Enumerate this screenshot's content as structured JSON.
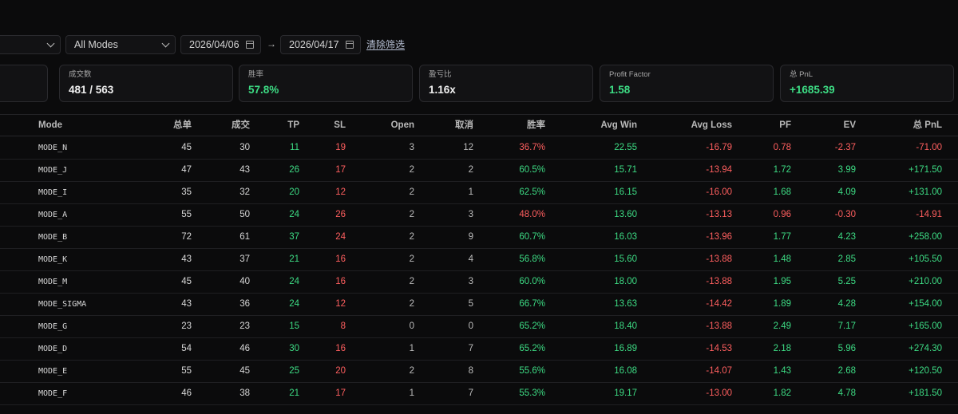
{
  "filters": {
    "mode_select": {
      "value": "All Modes"
    },
    "date_from": "2026/04/06",
    "date_to": "2026/04/17",
    "range_arrow": "→",
    "clear_label": "清除筛选"
  },
  "stats": [
    {
      "label": "成交数",
      "value": "481 / 563",
      "tone": "neutral"
    },
    {
      "label": "胜率",
      "value": "57.8%",
      "tone": "green"
    },
    {
      "label": "盈亏比",
      "value": "1.16x",
      "tone": "neutral"
    },
    {
      "label": "Profit Factor",
      "value": "1.58",
      "tone": "green"
    },
    {
      "label": "总 PnL",
      "value": "+1685.39",
      "tone": "green"
    }
  ],
  "table": {
    "columns": [
      "Mode",
      "总单",
      "成交",
      "TP",
      "SL",
      "Open",
      "取消",
      "胜率",
      "Avg Win",
      "Avg Loss",
      "PF",
      "EV",
      "总 PnL"
    ],
    "rows": [
      {
        "mode": "MODE_N",
        "total": "45",
        "filled": "30",
        "tp": "11",
        "sl": "19",
        "open": "3",
        "cancel": "12",
        "winrate": "36.7%",
        "winrate_tone": "neg",
        "avg_win": "22.55",
        "avg_loss": "-16.79",
        "pf": "0.78",
        "pf_tone": "neg",
        "ev": "-2.37",
        "ev_tone": "neg",
        "pnl": "-71.00",
        "pnl_tone": "neg"
      },
      {
        "mode": "MODE_J",
        "total": "47",
        "filled": "43",
        "tp": "26",
        "sl": "17",
        "open": "2",
        "cancel": "2",
        "winrate": "60.5%",
        "winrate_tone": "pos",
        "avg_win": "15.71",
        "avg_loss": "-13.94",
        "pf": "1.72",
        "pf_tone": "pos",
        "ev": "3.99",
        "ev_tone": "pos",
        "pnl": "+171.50",
        "pnl_tone": "pos"
      },
      {
        "mode": "MODE_I",
        "total": "35",
        "filled": "32",
        "tp": "20",
        "sl": "12",
        "open": "2",
        "cancel": "1",
        "winrate": "62.5%",
        "winrate_tone": "pos",
        "avg_win": "16.15",
        "avg_loss": "-16.00",
        "pf": "1.68",
        "pf_tone": "pos",
        "ev": "4.09",
        "ev_tone": "pos",
        "pnl": "+131.00",
        "pnl_tone": "pos"
      },
      {
        "mode": "MODE_A",
        "total": "55",
        "filled": "50",
        "tp": "24",
        "sl": "26",
        "open": "2",
        "cancel": "3",
        "winrate": "48.0%",
        "winrate_tone": "neg",
        "avg_win": "13.60",
        "avg_loss": "-13.13",
        "pf": "0.96",
        "pf_tone": "neg",
        "ev": "-0.30",
        "ev_tone": "neg",
        "pnl": "-14.91",
        "pnl_tone": "neg"
      },
      {
        "mode": "MODE_B",
        "total": "72",
        "filled": "61",
        "tp": "37",
        "sl": "24",
        "open": "2",
        "cancel": "9",
        "winrate": "60.7%",
        "winrate_tone": "pos",
        "avg_win": "16.03",
        "avg_loss": "-13.96",
        "pf": "1.77",
        "pf_tone": "pos",
        "ev": "4.23",
        "ev_tone": "pos",
        "pnl": "+258.00",
        "pnl_tone": "pos"
      },
      {
        "mode": "MODE_K",
        "total": "43",
        "filled": "37",
        "tp": "21",
        "sl": "16",
        "open": "2",
        "cancel": "4",
        "winrate": "56.8%",
        "winrate_tone": "pos",
        "avg_win": "15.60",
        "avg_loss": "-13.88",
        "pf": "1.48",
        "pf_tone": "pos",
        "ev": "2.85",
        "ev_tone": "pos",
        "pnl": "+105.50",
        "pnl_tone": "pos"
      },
      {
        "mode": "MODE_M",
        "total": "45",
        "filled": "40",
        "tp": "24",
        "sl": "16",
        "open": "2",
        "cancel": "3",
        "winrate": "60.0%",
        "winrate_tone": "pos",
        "avg_win": "18.00",
        "avg_loss": "-13.88",
        "pf": "1.95",
        "pf_tone": "pos",
        "ev": "5.25",
        "ev_tone": "pos",
        "pnl": "+210.00",
        "pnl_tone": "pos"
      },
      {
        "mode": "MODE_SIGMA",
        "total": "43",
        "filled": "36",
        "tp": "24",
        "sl": "12",
        "open": "2",
        "cancel": "5",
        "winrate": "66.7%",
        "winrate_tone": "pos",
        "avg_win": "13.63",
        "avg_loss": "-14.42",
        "pf": "1.89",
        "pf_tone": "pos",
        "ev": "4.28",
        "ev_tone": "pos",
        "pnl": "+154.00",
        "pnl_tone": "pos"
      },
      {
        "mode": "MODE_G",
        "total": "23",
        "filled": "23",
        "tp": "15",
        "sl": "8",
        "open": "0",
        "cancel": "0",
        "winrate": "65.2%",
        "winrate_tone": "pos",
        "avg_win": "18.40",
        "avg_loss": "-13.88",
        "pf": "2.49",
        "pf_tone": "pos",
        "ev": "7.17",
        "ev_tone": "pos",
        "pnl": "+165.00",
        "pnl_tone": "pos"
      },
      {
        "mode": "MODE_D",
        "total": "54",
        "filled": "46",
        "tp": "30",
        "sl": "16",
        "open": "1",
        "cancel": "7",
        "winrate": "65.2%",
        "winrate_tone": "pos",
        "avg_win": "16.89",
        "avg_loss": "-14.53",
        "pf": "2.18",
        "pf_tone": "pos",
        "ev": "5.96",
        "ev_tone": "pos",
        "pnl": "+274.30",
        "pnl_tone": "pos"
      },
      {
        "mode": "MODE_E",
        "total": "55",
        "filled": "45",
        "tp": "25",
        "sl": "20",
        "open": "2",
        "cancel": "8",
        "winrate": "55.6%",
        "winrate_tone": "pos",
        "avg_win": "16.08",
        "avg_loss": "-14.07",
        "pf": "1.43",
        "pf_tone": "pos",
        "ev": "2.68",
        "ev_tone": "pos",
        "pnl": "+120.50",
        "pnl_tone": "pos"
      },
      {
        "mode": "MODE_F",
        "total": "46",
        "filled": "38",
        "tp": "21",
        "sl": "17",
        "open": "1",
        "cancel": "7",
        "winrate": "55.3%",
        "winrate_tone": "pos",
        "avg_win": "19.17",
        "avg_loss": "-13.00",
        "pf": "1.82",
        "pf_tone": "pos",
        "ev": "4.78",
        "ev_tone": "pos",
        "pnl": "+181.50",
        "pnl_tone": "pos"
      }
    ]
  },
  "colors": {
    "positive": "#3ddc84",
    "negative": "#ff5f5f",
    "background": "#0b0b0c",
    "card": "#121214"
  }
}
